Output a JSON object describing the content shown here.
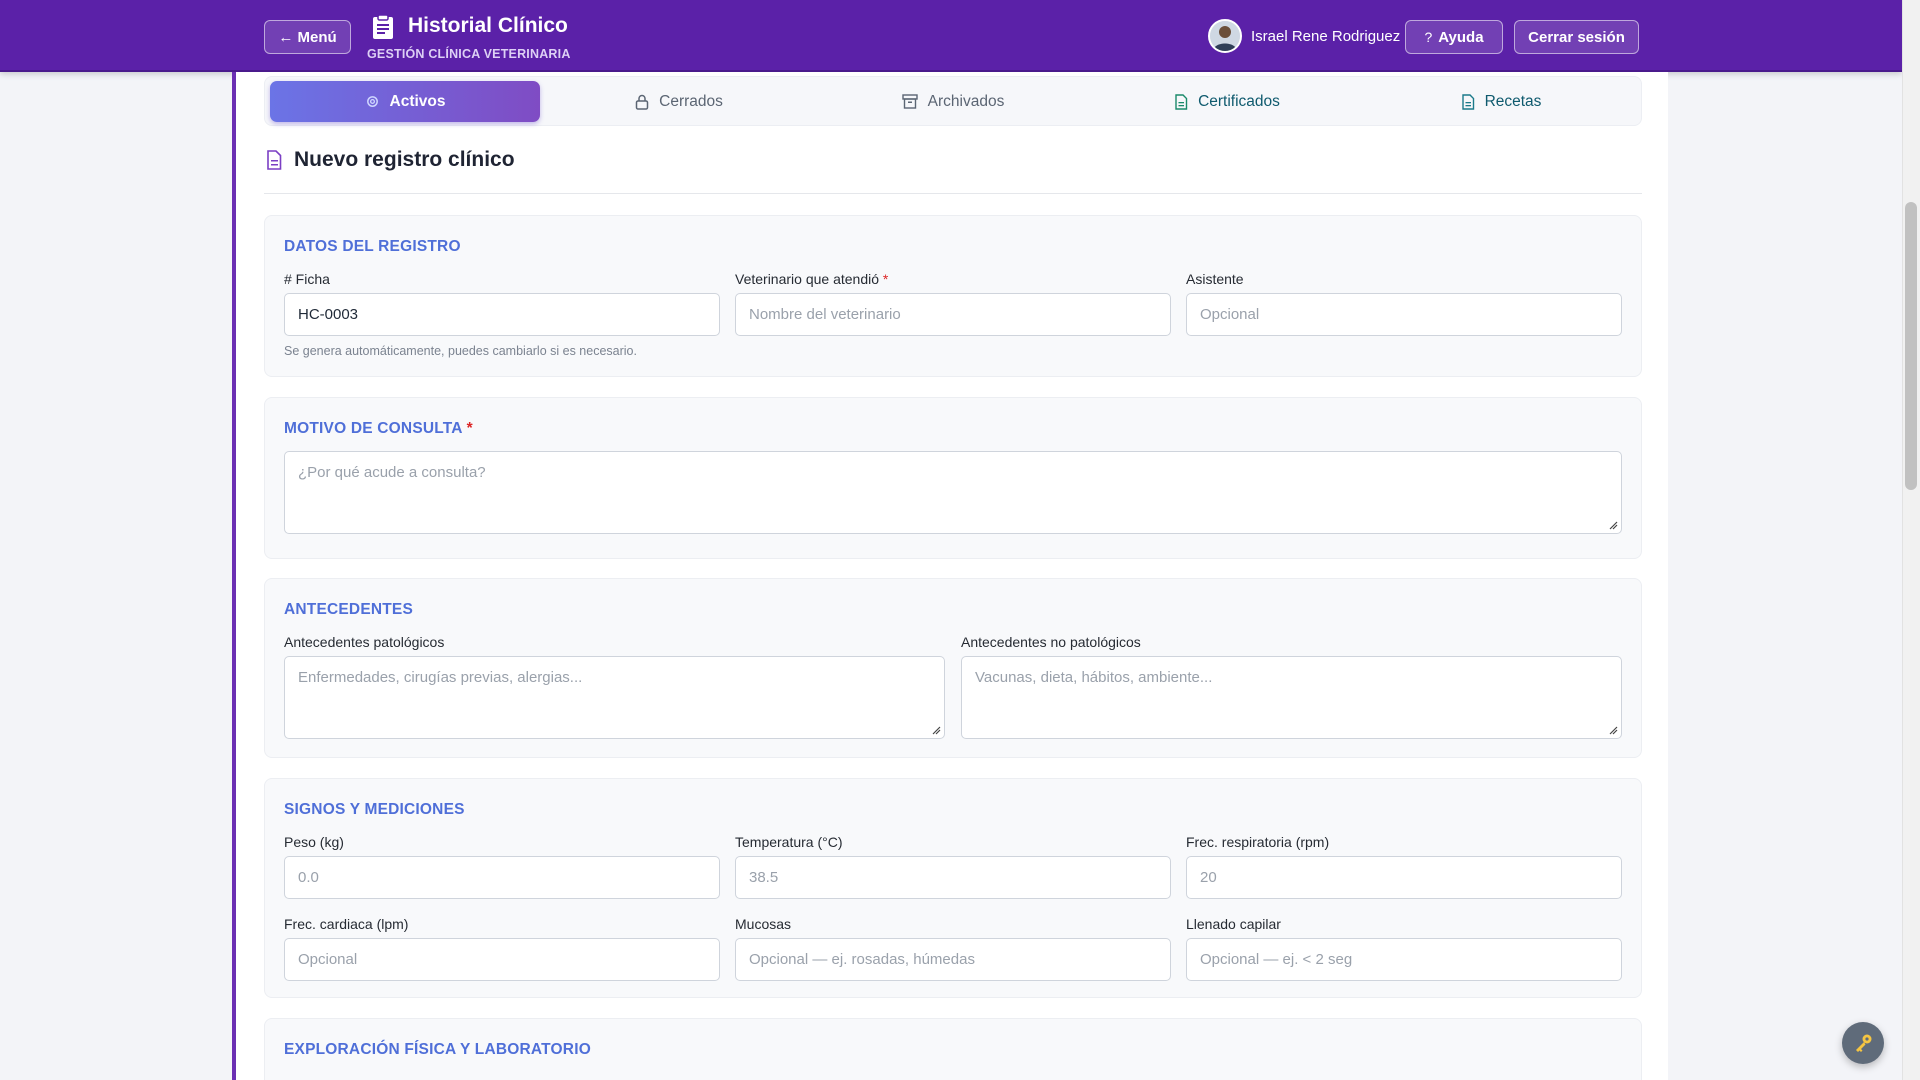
{
  "header": {
    "menu_label": "← Menú",
    "title": "Historial Clínico",
    "subtitle": "GESTIÓN CLÍNICA VETERINARIA",
    "user_name": "Israel Rene Rodriguez",
    "help_label": "Ayuda",
    "logout_label": "Cerrar sesión"
  },
  "tabs": [
    {
      "label": "Activos",
      "icon": "gear-icon",
      "active": true
    },
    {
      "label": "Cerrados",
      "icon": "lock-icon"
    },
    {
      "label": "Archivados",
      "icon": "archive-icon"
    },
    {
      "label": "Certificados",
      "icon": "document-icon"
    },
    {
      "label": "Recetas",
      "icon": "document-icon"
    }
  ],
  "page": {
    "heading": "Nuevo registro clínico"
  },
  "registro": {
    "title": "DATOS DEL REGISTRO",
    "ficha_label": "# Ficha",
    "ficha_value": "HC-0003",
    "ficha_hint": "Se genera automáticamente, puedes cambiarlo si es necesario.",
    "veterinario_label": "Veterinario que atendió",
    "veterinario_placeholder": "Nombre del veterinario",
    "asistente_label": "Asistente",
    "asistente_placeholder": "Opcional"
  },
  "motivo": {
    "title": "MOTIVO DE CONSULTA",
    "placeholder": "¿Por qué acude a consulta?"
  },
  "antecedentes": {
    "title": "ANTECEDENTES",
    "patologicos_label": "Antecedentes patológicos",
    "patologicos_placeholder": "Enfermedades, cirugías previas, alergias...",
    "no_patologicos_label": "Antecedentes no patológicos",
    "no_patologicos_placeholder": "Vacunas, dieta, hábitos, ambiente..."
  },
  "signos": {
    "title": "SIGNOS Y MEDICIONES",
    "peso_label": "Peso (kg)",
    "peso_placeholder": "0.0",
    "temp_label": "Temperatura (°C)",
    "temp_placeholder": "38.5",
    "fr_label": "Frec. respiratoria (rpm)",
    "fr_placeholder": "20",
    "fc_label": "Frec. cardiaca (lpm)",
    "fc_placeholder": "Opcional",
    "mucosas_label": "Mucosas",
    "mucosas_placeholder": "Opcional — ej. rosadas, húmedas",
    "llenado_label": "Llenado capilar",
    "llenado_placeholder": "Opcional — ej. < 2 seg"
  },
  "exploracion": {
    "title": "EXPLORACIÓN FÍSICA Y LABORATORIO"
  },
  "colors": {
    "header_bg": "#5b21a8",
    "accent_blue": "#4f6fd8",
    "required_red": "#dc2626"
  }
}
